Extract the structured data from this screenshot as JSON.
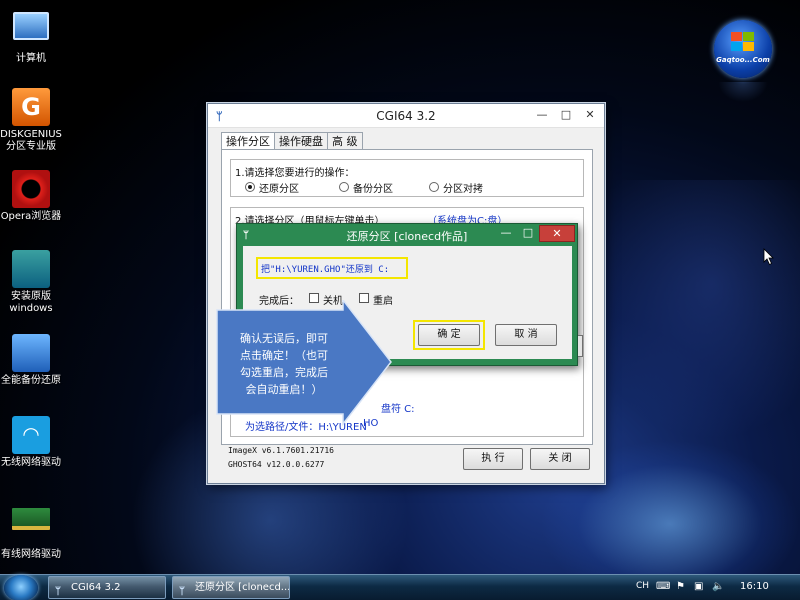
{
  "desktop": {
    "icons": [
      {
        "label": "计算机",
        "icon": "computer-icon"
      },
      {
        "label": "DISKGENIUS",
        "label2": "分区专业版",
        "icon": "diskgenius-icon"
      },
      {
        "label": "Opera浏览器",
        "icon": "opera-icon"
      },
      {
        "label": "安装原版",
        "label2": "windows",
        "icon": "windows-install-icon"
      },
      {
        "label": "全能备份还原",
        "icon": "backup-restore-icon"
      },
      {
        "label": "无线网络驱动",
        "icon": "wifi-icon"
      },
      {
        "label": "有线网络驱动",
        "icon": "network-card-icon"
      }
    ],
    "logo_text": "Gaqtoo...Com"
  },
  "main_window": {
    "title": "CGI64  3.2",
    "tabs": [
      "操作分区",
      "操作硬盘",
      "高 级"
    ],
    "step1_label": "1.请选择您要进行的操作：",
    "options": [
      "还原分区",
      "备份分区",
      "分区对拷"
    ],
    "selected_option": "还原分区",
    "step2_label": "2.请选择分区（用鼠标左键单击）",
    "system_disk_note": "（系统盘为C:盘）",
    "partition_label": "盘符 C:",
    "path_prefix": "为选路径/文件：H:\\YUREN",
    "path_suffix": "HO",
    "imagex_version": "ImageX v6.1.7601.21716",
    "ghost_version": "GHOST64 v12.0.0.6277",
    "execute_button": "执 行",
    "close_button": "关 闭"
  },
  "dialog": {
    "title": "还原分区  [clonecd作品]",
    "message": "把\"H:\\YUREN.GHO\"还原到 C:",
    "after_label": "完成后：",
    "shutdown_label": "关机",
    "restart_label": "重启",
    "ok_button": "确 定",
    "cancel_button": "取 消",
    "minimize": "—",
    "maximize": "□",
    "close": "✕"
  },
  "callout": {
    "lines": [
      "确认无误后，即可",
      "点击确定！（也可",
      "勾选重启，完成后",
      "会自动重启！）"
    ]
  },
  "taskbar": {
    "items": [
      "CGI64  3.2",
      "还原分区  [clonecd..."
    ],
    "tray_lang": "CH",
    "clock": "16:10"
  },
  "colors": {
    "dialog_title": "#2c8a52",
    "highlight": "#f4e600",
    "callout": "#4a78c4"
  }
}
